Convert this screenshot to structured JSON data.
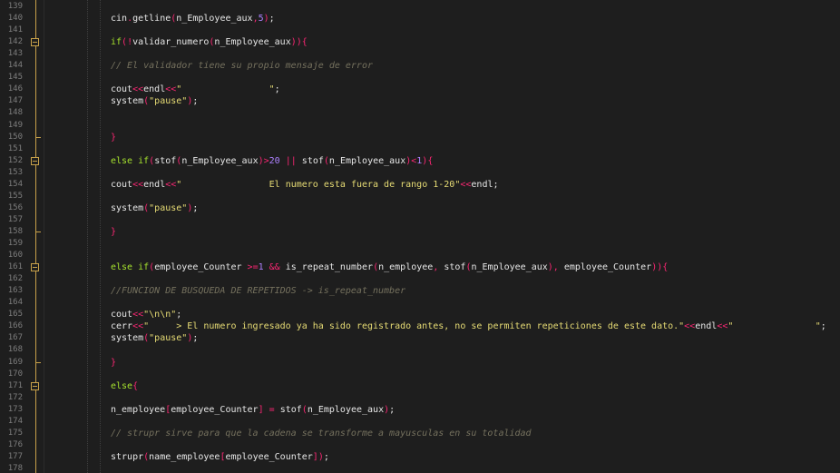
{
  "editor": {
    "colors": {
      "background": "#1e1e1e",
      "line_number": "#7d7d7d",
      "fold_marker": "#c8a14a",
      "keyword": "#a6e22e",
      "operator": "#f92672",
      "number": "#ae81ff",
      "string": "#e6db74",
      "comment": "#75715e",
      "text": "#e6e6e6"
    },
    "lines": [
      {
        "n": "139",
        "fold": "",
        "tokens": []
      },
      {
        "n": "140",
        "fold": "",
        "tokens": [
          [
            "txt",
            "cin"
          ],
          [
            "op",
            "."
          ],
          [
            "txt",
            "getline"
          ],
          [
            "op",
            "("
          ],
          [
            "txt",
            "n_Employee_aux"
          ],
          [
            "op",
            ","
          ],
          [
            "num",
            "5"
          ],
          [
            "op",
            ")"
          ],
          [
            "txt",
            ";"
          ]
        ]
      },
      {
        "n": "141",
        "fold": "",
        "tokens": []
      },
      {
        "n": "142",
        "fold": "open",
        "tokens": [
          [
            "kw",
            "if"
          ],
          [
            "op",
            "(!"
          ],
          [
            "txt",
            "validar_numero"
          ],
          [
            "op",
            "("
          ],
          [
            "txt",
            "n_Employee_aux"
          ],
          [
            "op",
            ")"
          ],
          [
            "op",
            "){"
          ]
        ]
      },
      {
        "n": "143",
        "fold": "",
        "tokens": []
      },
      {
        "n": "144",
        "fold": "",
        "tokens": [
          [
            "cmt",
            "// El validador tiene su propio mensaje de error"
          ]
        ]
      },
      {
        "n": "145",
        "fold": "",
        "tokens": []
      },
      {
        "n": "146",
        "fold": "",
        "tokens": [
          [
            "txt",
            "cout"
          ],
          [
            "op",
            "<<"
          ],
          [
            "txt",
            "endl"
          ],
          [
            "op",
            "<<"
          ],
          [
            "str",
            "\"                \""
          ],
          [
            "txt",
            ";"
          ]
        ]
      },
      {
        "n": "147",
        "fold": "",
        "tokens": [
          [
            "txt",
            "system"
          ],
          [
            "op",
            "("
          ],
          [
            "str",
            "\"pause\""
          ],
          [
            "op",
            ")"
          ],
          [
            "txt",
            ";"
          ]
        ]
      },
      {
        "n": "148",
        "fold": "",
        "tokens": []
      },
      {
        "n": "149",
        "fold": "",
        "tokens": []
      },
      {
        "n": "150",
        "fold": "end",
        "tokens": [
          [
            "op",
            "}"
          ]
        ]
      },
      {
        "n": "151",
        "fold": "",
        "tokens": []
      },
      {
        "n": "152",
        "fold": "open",
        "tokens": [
          [
            "kw",
            "else if"
          ],
          [
            "op",
            "("
          ],
          [
            "txt",
            "stof"
          ],
          [
            "op",
            "("
          ],
          [
            "txt",
            "n_Employee_aux"
          ],
          [
            "op",
            ")>"
          ],
          [
            "num",
            "20"
          ],
          [
            "txt",
            " "
          ],
          [
            "op",
            "||"
          ],
          [
            "txt",
            " stof"
          ],
          [
            "op",
            "("
          ],
          [
            "txt",
            "n_Employee_aux"
          ],
          [
            "op",
            ")<"
          ],
          [
            "num",
            "1"
          ],
          [
            "op",
            "){"
          ]
        ]
      },
      {
        "n": "153",
        "fold": "",
        "tokens": []
      },
      {
        "n": "154",
        "fold": "",
        "tokens": [
          [
            "txt",
            "cout"
          ],
          [
            "op",
            "<<"
          ],
          [
            "txt",
            "endl"
          ],
          [
            "op",
            "<<"
          ],
          [
            "str",
            "\"                El numero esta fuera de rango 1-20\""
          ],
          [
            "op",
            "<<"
          ],
          [
            "txt",
            "endl;"
          ]
        ]
      },
      {
        "n": "155",
        "fold": "",
        "tokens": []
      },
      {
        "n": "156",
        "fold": "",
        "tokens": [
          [
            "txt",
            "system"
          ],
          [
            "op",
            "("
          ],
          [
            "str",
            "\"pause\""
          ],
          [
            "op",
            ")"
          ],
          [
            "txt",
            ";"
          ]
        ]
      },
      {
        "n": "157",
        "fold": "",
        "tokens": []
      },
      {
        "n": "158",
        "fold": "end",
        "tokens": [
          [
            "op",
            "}"
          ]
        ]
      },
      {
        "n": "159",
        "fold": "",
        "tokens": []
      },
      {
        "n": "160",
        "fold": "",
        "tokens": []
      },
      {
        "n": "161",
        "fold": "open",
        "tokens": [
          [
            "kw",
            "else if"
          ],
          [
            "op",
            "("
          ],
          [
            "txt",
            "employee_Counter "
          ],
          [
            "op",
            ">="
          ],
          [
            "num",
            "1"
          ],
          [
            "txt",
            " "
          ],
          [
            "op",
            "&&"
          ],
          [
            "txt",
            " is_repeat_number"
          ],
          [
            "op",
            "("
          ],
          [
            "txt",
            "n_employee"
          ],
          [
            "op",
            ","
          ],
          [
            "txt",
            " stof"
          ],
          [
            "op",
            "("
          ],
          [
            "txt",
            "n_Employee_aux"
          ],
          [
            "op",
            "),"
          ],
          [
            "txt",
            " employee_Counter"
          ],
          [
            "op",
            "))"
          ],
          [
            "op",
            "{"
          ]
        ]
      },
      {
        "n": "162",
        "fold": "",
        "tokens": []
      },
      {
        "n": "163",
        "fold": "",
        "tokens": [
          [
            "cmt",
            "//FUNCION DE BUSQUEDA DE REPETIDOS -> is_repeat_number"
          ]
        ]
      },
      {
        "n": "164",
        "fold": "",
        "tokens": []
      },
      {
        "n": "165",
        "fold": "",
        "tokens": [
          [
            "txt",
            "cout"
          ],
          [
            "op",
            "<<"
          ],
          [
            "str",
            "\"\\n\\n\""
          ],
          [
            "txt",
            ";"
          ]
        ]
      },
      {
        "n": "166",
        "fold": "",
        "tokens": [
          [
            "txt",
            "cerr"
          ],
          [
            "op",
            "<<"
          ],
          [
            "str",
            "\"     > El numero ingresado ya ha sido registrado antes, no se permiten repeticiones de este dato.\""
          ],
          [
            "op",
            "<<"
          ],
          [
            "txt",
            "endl"
          ],
          [
            "op",
            "<<"
          ],
          [
            "str",
            "\"               \""
          ],
          [
            "txt",
            ";"
          ]
        ]
      },
      {
        "n": "167",
        "fold": "",
        "tokens": [
          [
            "txt",
            "system"
          ],
          [
            "op",
            "("
          ],
          [
            "str",
            "\"pause\""
          ],
          [
            "op",
            ")"
          ],
          [
            "txt",
            ";"
          ]
        ]
      },
      {
        "n": "168",
        "fold": "",
        "tokens": []
      },
      {
        "n": "169",
        "fold": "end",
        "tokens": [
          [
            "op",
            "}"
          ]
        ]
      },
      {
        "n": "170",
        "fold": "",
        "tokens": []
      },
      {
        "n": "171",
        "fold": "open",
        "tokens": [
          [
            "kw",
            "else"
          ],
          [
            "op",
            "{"
          ]
        ]
      },
      {
        "n": "172",
        "fold": "",
        "tokens": []
      },
      {
        "n": "173",
        "fold": "",
        "tokens": [
          [
            "txt",
            "n_employee"
          ],
          [
            "op",
            "["
          ],
          [
            "txt",
            "employee_Counter"
          ],
          [
            "op",
            "]"
          ],
          [
            "txt",
            " "
          ],
          [
            "op",
            "="
          ],
          [
            "txt",
            " stof"
          ],
          [
            "op",
            "("
          ],
          [
            "txt",
            "n_Employee_aux"
          ],
          [
            "op",
            ")"
          ],
          [
            "txt",
            ";"
          ]
        ]
      },
      {
        "n": "174",
        "fold": "",
        "tokens": []
      },
      {
        "n": "175",
        "fold": "",
        "tokens": [
          [
            "cmt",
            "// strupr sirve para que la cadena se transforme a mayusculas en su totalidad"
          ]
        ]
      },
      {
        "n": "176",
        "fold": "",
        "tokens": []
      },
      {
        "n": "177",
        "fold": "",
        "tokens": [
          [
            "txt",
            "strupr"
          ],
          [
            "op",
            "("
          ],
          [
            "txt",
            "name_employee"
          ],
          [
            "op",
            "["
          ],
          [
            "txt",
            "employee_Counter"
          ],
          [
            "op",
            "]"
          ],
          [
            "op",
            ")"
          ],
          [
            "txt",
            ";"
          ]
        ]
      },
      {
        "n": "178",
        "fold": "",
        "tokens": []
      }
    ]
  }
}
